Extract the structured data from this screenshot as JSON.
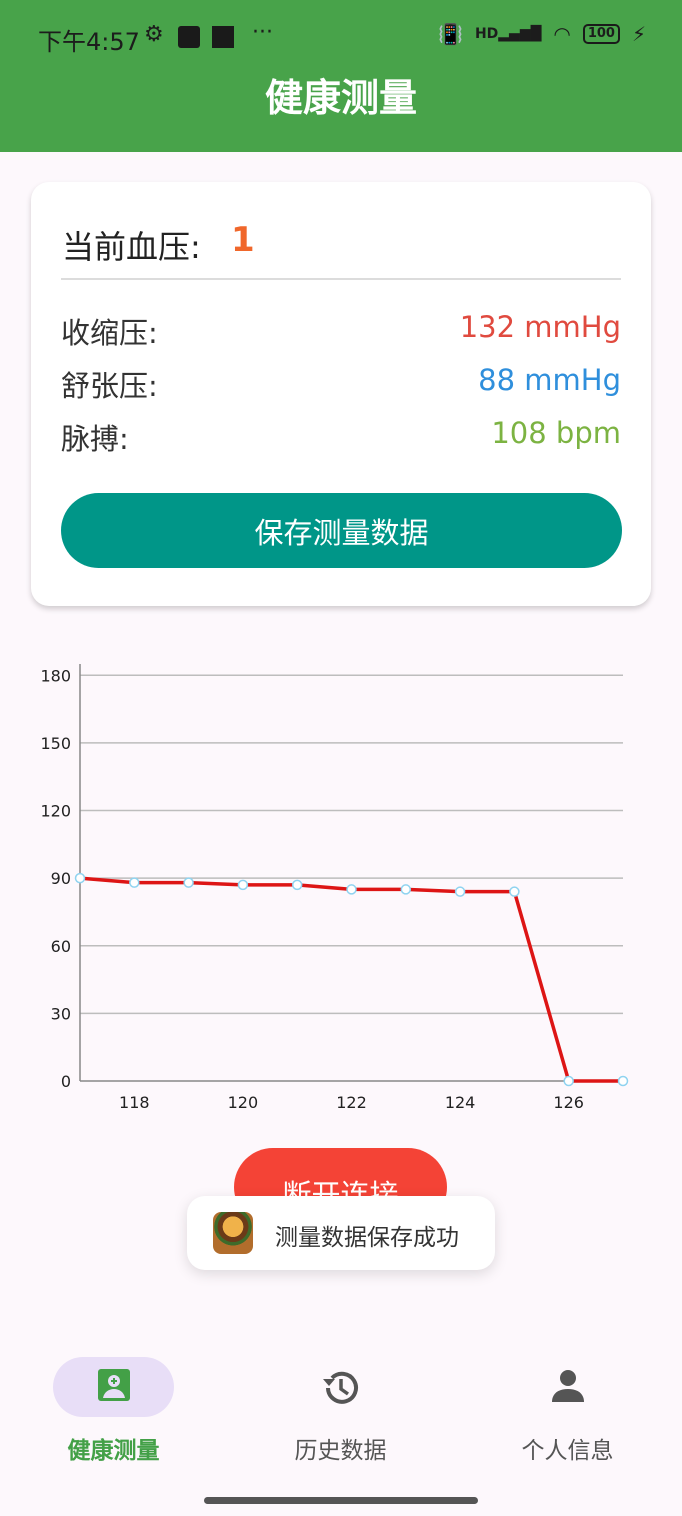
{
  "status": {
    "time": "下午4:57",
    "dots": "···",
    "signal": "HD",
    "battery": "100"
  },
  "app": {
    "title": "健康测量"
  },
  "card": {
    "current_bp_label": "当前血压:",
    "current_bp_value": "1",
    "systolic_label": "收缩压:",
    "systolic_value": "132 mmHg",
    "diastolic_label": "舒张压:",
    "diastolic_value": "88 mmHg",
    "pulse_label": "脉搏:",
    "pulse_value": "108 bpm",
    "save_label": "保存测量数据",
    "colors": {
      "systolic": "#e04a3f",
      "diastolic": "#2f8fdc",
      "pulse": "#7cb342",
      "accent": "#f0672b",
      "button": "#009688"
    }
  },
  "chart_data": {
    "type": "line",
    "x": [
      117,
      118,
      119,
      120,
      121,
      122,
      123,
      124,
      125,
      126,
      127
    ],
    "series": [
      {
        "values": [
          90,
          88,
          88,
          87,
          87,
          85,
          85,
          84,
          84,
          0,
          0
        ],
        "color": "#dd1515"
      }
    ],
    "xticks": [
      118,
      120,
      122,
      124,
      126
    ],
    "yticks": [
      0,
      30,
      60,
      90,
      120,
      150,
      180
    ],
    "xlim": [
      117,
      127
    ],
    "ylim": [
      0,
      185
    ],
    "grid": true,
    "title": "",
    "xlabel": "",
    "ylabel": ""
  },
  "actions": {
    "disconnect_label": "断开连接"
  },
  "toast": {
    "message": "测量数据保存成功"
  },
  "nav": {
    "items": [
      {
        "label": "健康测量",
        "icon": "health-record-icon",
        "active": true
      },
      {
        "label": "历史数据",
        "icon": "history-icon",
        "active": false
      },
      {
        "label": "个人信息",
        "icon": "person-icon",
        "active": false
      }
    ],
    "active_color": "#43a047",
    "inactive_color": "#555555"
  }
}
